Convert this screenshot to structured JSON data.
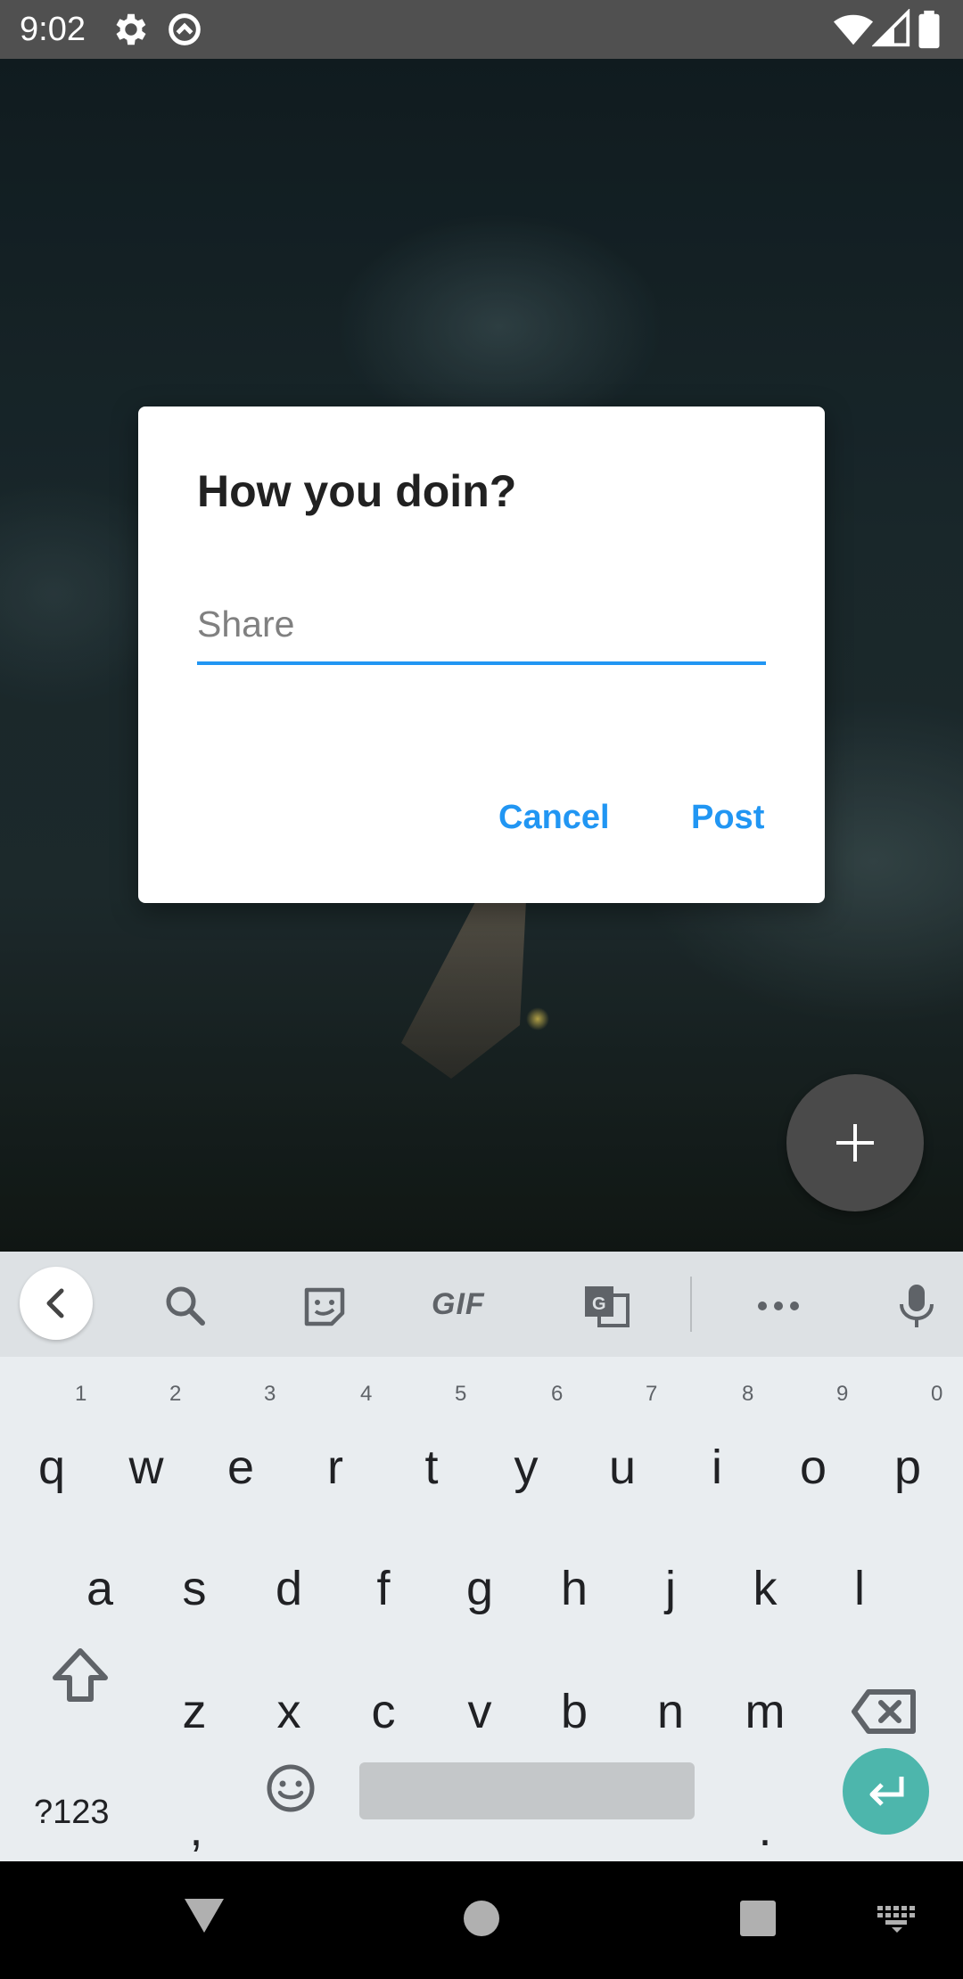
{
  "status_bar": {
    "time": "9:02",
    "icons": [
      "settings-icon",
      "sync-icon",
      "wifi-icon",
      "signal-icon",
      "battery-icon"
    ]
  },
  "dialog": {
    "title": "How you doin?",
    "input_placeholder": "Share",
    "input_value": "",
    "cancel_label": "Cancel",
    "post_label": "Post",
    "accent_color": "#2196f3"
  },
  "fab": {
    "icon": "plus-icon"
  },
  "keyboard": {
    "toolbar": {
      "icons": [
        "back-icon",
        "search-icon",
        "sticker-icon",
        "gif-icon",
        "translate-icon",
        "more-icon",
        "mic-icon"
      ],
      "gif_label": "GIF"
    },
    "row1": [
      {
        "key": "q",
        "hint": "1"
      },
      {
        "key": "w",
        "hint": "2"
      },
      {
        "key": "e",
        "hint": "3"
      },
      {
        "key": "r",
        "hint": "4"
      },
      {
        "key": "t",
        "hint": "5"
      },
      {
        "key": "y",
        "hint": "6"
      },
      {
        "key": "u",
        "hint": "7"
      },
      {
        "key": "i",
        "hint": "8"
      },
      {
        "key": "o",
        "hint": "9"
      },
      {
        "key": "p",
        "hint": "0"
      }
    ],
    "row2": [
      "a",
      "s",
      "d",
      "f",
      "g",
      "h",
      "j",
      "k",
      "l"
    ],
    "row3": [
      "z",
      "x",
      "c",
      "v",
      "b",
      "n",
      "m"
    ],
    "symbols_label": "?123",
    "comma": ",",
    "period": ".",
    "enter_color": "#4db6ac"
  },
  "nav_bar": {
    "icons": [
      "back-triangle-icon",
      "home-circle-icon",
      "recents-square-icon",
      "keyboard-switch-icon"
    ]
  }
}
